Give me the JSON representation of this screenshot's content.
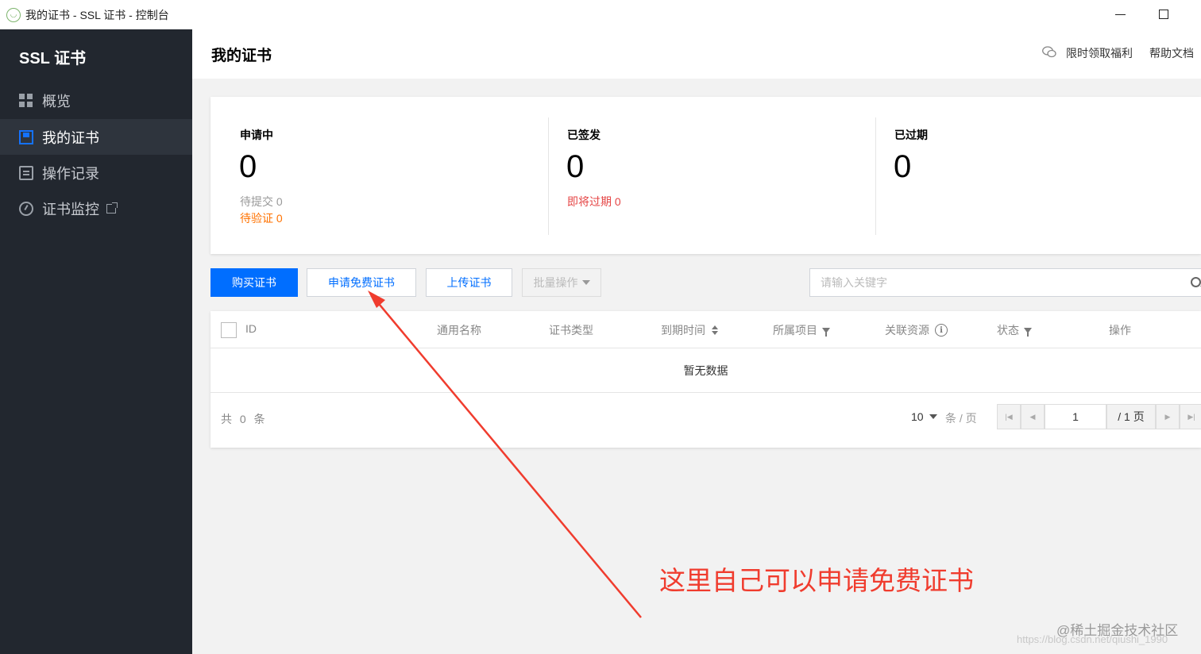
{
  "window": {
    "title": "我的证书 - SSL 证书 - 控制台"
  },
  "sidebar": {
    "brand": "SSL 证书",
    "items": [
      {
        "label": "概览",
        "icon": "grid-icon"
      },
      {
        "label": "我的证书",
        "icon": "certificate-icon",
        "active": true
      },
      {
        "label": "操作记录",
        "icon": "log-icon"
      },
      {
        "label": "证书监控",
        "icon": "monitor-icon",
        "external": true
      }
    ]
  },
  "header": {
    "title": "我的证书",
    "links": [
      "限时领取福利",
      "帮助文档"
    ]
  },
  "stats": [
    {
      "label": "申请中",
      "value": "0",
      "subs": [
        {
          "text": "待提交 0",
          "tone": "gray"
        },
        {
          "text": "待验证 0",
          "tone": "orange"
        }
      ]
    },
    {
      "label": "已签发",
      "value": "0",
      "subs": [
        {
          "text": "即将过期 0",
          "tone": "red"
        }
      ]
    },
    {
      "label": "已过期",
      "value": "0",
      "subs": []
    }
  ],
  "toolbar": {
    "buy_label": "购买证书",
    "apply_free_label": "申请免费证书",
    "upload_label": "上传证书",
    "batch_label": "批量操作",
    "search_placeholder": "请输入关键字"
  },
  "table": {
    "columns": [
      "ID",
      "通用名称",
      "证书类型",
      "到期时间",
      "所属项目",
      "关联资源",
      "状态",
      "操作"
    ],
    "empty_text": "暂无数据",
    "total_text": "共 0 条",
    "page_size": "10",
    "per_page_label": "条 / 页",
    "current_page": "1",
    "total_pages_label": "/ 1 页"
  },
  "annotation": {
    "text": "这里自己可以申请免费证书",
    "color": "#f03c2e"
  },
  "watermark": {
    "text": "@稀土掘金技术社区",
    "url_text": "https://blog.csdn.net/qiushi_1990"
  },
  "colors": {
    "sidebar_bg": "#22272f",
    "primary": "#006eff",
    "warning": "#ff7200",
    "danger": "#e54545"
  }
}
